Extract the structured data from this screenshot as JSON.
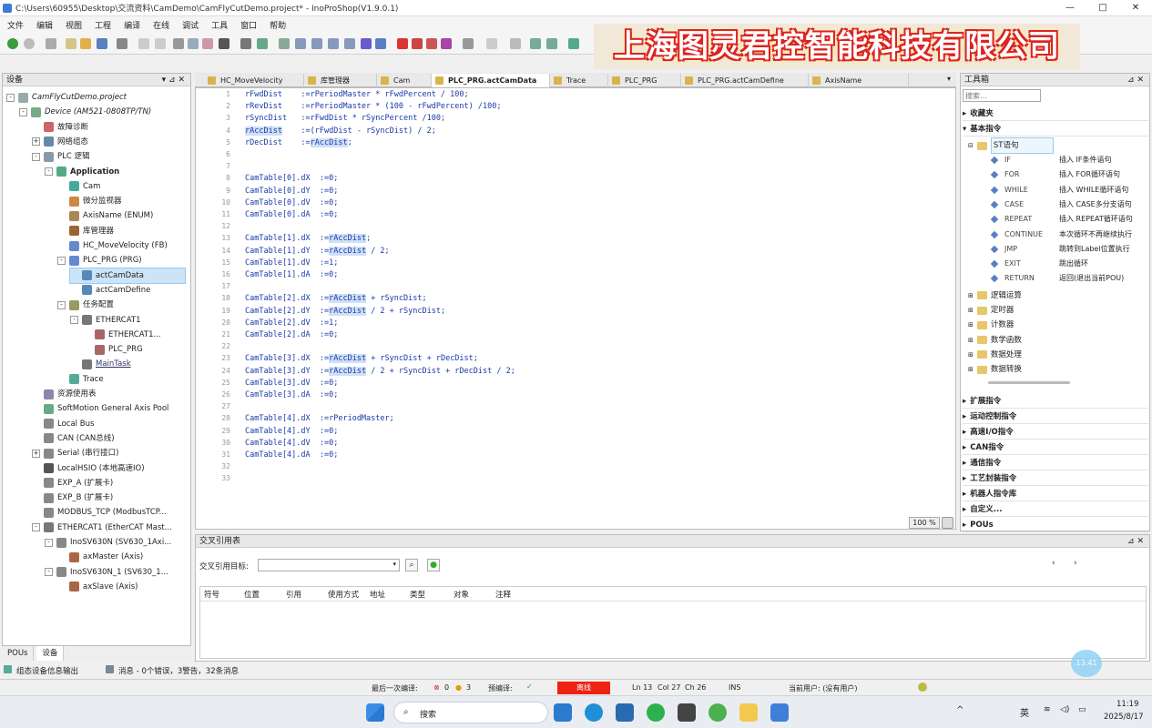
{
  "window": {
    "title": "C:\\Users\\60955\\Desktop\\交流资料\\CamDemo\\CamFlyCutDemo.project* - InoProShop(V1.9.0.1)",
    "minimize": "—",
    "maximize": "□",
    "close": "✕"
  },
  "menu": [
    "文件",
    "编辑",
    "视图",
    "工程",
    "编译",
    "在线",
    "调试",
    "工具",
    "窗口",
    "帮助"
  ],
  "banner": "上海图灵君控智能科技有限公司",
  "device_panel": {
    "title": "设备",
    "pin": "▾ ⊿ ✕",
    "tree": [
      {
        "label": "CamFlyCutDemo.project",
        "indent": 0,
        "expander": "-",
        "icon": "#9aa"
      },
      {
        "label": "Device (AM521-0808TP/TN)",
        "indent": 1,
        "expander": "-",
        "icon": "#7a8"
      },
      {
        "label": "故障诊断",
        "indent": 2,
        "expander": "",
        "icon": "#c66"
      },
      {
        "label": "网络组态",
        "indent": 2,
        "expander": "+",
        "icon": "#68a"
      },
      {
        "label": "PLC 逻辑",
        "indent": 2,
        "expander": "-",
        "icon": "#89a"
      },
      {
        "label": "Application",
        "indent": 3,
        "expander": "-",
        "icon": "#5a8",
        "bold": true
      },
      {
        "label": "Cam",
        "indent": 4,
        "expander": "",
        "icon": "#4a9"
      },
      {
        "label": "微分监视器",
        "indent": 4,
        "expander": "",
        "icon": "#c84"
      },
      {
        "label": "AxisName (ENUM)",
        "indent": 4,
        "expander": "",
        "icon": "#a85"
      },
      {
        "label": "库管理器",
        "indent": 4,
        "expander": "",
        "icon": "#963"
      },
      {
        "label": "HC_MoveVelocity (FB)",
        "indent": 4,
        "expander": "",
        "icon": "#68c"
      },
      {
        "label": "PLC_PRG (PRG)",
        "indent": 4,
        "expander": "-",
        "icon": "#68c"
      },
      {
        "label": "actCamData",
        "indent": 5,
        "expander": "",
        "icon": "#58b",
        "selected": true
      },
      {
        "label": "actCamDefine",
        "indent": 5,
        "expander": "",
        "icon": "#58b"
      },
      {
        "label": "任务配置",
        "indent": 4,
        "expander": "-",
        "icon": "#996"
      },
      {
        "label": "ETHERCAT1",
        "indent": 5,
        "expander": "-",
        "icon": "#777"
      },
      {
        "label": "ETHERCAT1...",
        "indent": 6,
        "expander": "",
        "icon": "#a66"
      },
      {
        "label": "PLC_PRG",
        "indent": 6,
        "expander": "",
        "icon": "#a66"
      },
      {
        "label": "MainTask",
        "indent": 5,
        "expander": "",
        "icon": "#777",
        "underline": true
      },
      {
        "label": "Trace",
        "indent": 4,
        "expander": "",
        "icon": "#5a9"
      },
      {
        "label": "资源使用表",
        "indent": 2,
        "expander": "",
        "icon": "#88a"
      },
      {
        "label": "SoftMotion General Axis Pool",
        "indent": 2,
        "expander": "",
        "icon": "#6a8"
      },
      {
        "label": "Local Bus",
        "indent": 2,
        "expander": "",
        "icon": "#888"
      },
      {
        "label": "CAN (CAN总线)",
        "indent": 2,
        "expander": "",
        "icon": "#888"
      },
      {
        "label": "Serial (串行接口)",
        "indent": 2,
        "expander": "+",
        "icon": "#888"
      },
      {
        "label": "LocalHSIO (本地高速IO)",
        "indent": 2,
        "expander": "",
        "icon": "#555"
      },
      {
        "label": "EXP_A (扩展卡)",
        "indent": 2,
        "expander": "",
        "icon": "#888"
      },
      {
        "label": "EXP_B (扩展卡)",
        "indent": 2,
        "expander": "",
        "icon": "#888"
      },
      {
        "label": "MODBUS_TCP (ModbusTCP...",
        "indent": 2,
        "expander": "",
        "icon": "#888"
      },
      {
        "label": "ETHERCAT1 (EtherCAT Mast...",
        "indent": 2,
        "expander": "-",
        "icon": "#777"
      },
      {
        "label": "InoSV630N (SV630_1Axi...",
        "indent": 3,
        "expander": "-",
        "icon": "#888"
      },
      {
        "label": "axMaster (Axis)",
        "indent": 4,
        "expander": "",
        "icon": "#a64"
      },
      {
        "label": "InoSV630N_1 (SV630_1...",
        "indent": 3,
        "expander": "-",
        "icon": "#888"
      },
      {
        "label": "axSlave (Axis)",
        "indent": 4,
        "expander": "",
        "icon": "#a64"
      }
    ],
    "bottom_tabs": [
      "POUs",
      "设备"
    ]
  },
  "editor_tabs": [
    {
      "label": "HC_MoveVelocity",
      "active": false
    },
    {
      "label": "库管理器",
      "active": false
    },
    {
      "label": "Cam",
      "active": false
    },
    {
      "label": "PLC_PRG.actCamData",
      "active": true
    },
    {
      "label": "Trace",
      "active": false
    },
    {
      "label": "PLC_PRG",
      "active": false
    },
    {
      "label": "PLC_PRG.actCamDefine",
      "active": false
    },
    {
      "label": "AxisName",
      "active": false
    }
  ],
  "code_lines": [
    {
      "n": "1",
      "text": "rFwdDist    :=rPeriodMaster * rFwdPercent / 100;"
    },
    {
      "n": "2",
      "text": "rRevDist    :=rPeriodMaster * (100 - rFwdPercent) /100;"
    },
    {
      "n": "3",
      "text": "rSyncDist   :=rFwdDist * rSyncPercent /100;"
    },
    {
      "n": "4",
      "text": "rAccDist    :=(rFwdDist - rSyncDist) / 2;"
    },
    {
      "n": "5",
      "text": "rDecDist    :=rAccDist;"
    },
    {
      "n": "6",
      "text": ""
    },
    {
      "n": "7",
      "text": ""
    },
    {
      "n": "8",
      "text": "CamTable[0].dX  :=0;"
    },
    {
      "n": "9",
      "text": "CamTable[0].dY  :=0;"
    },
    {
      "n": "10",
      "text": "CamTable[0].dV  :=0;"
    },
    {
      "n": "11",
      "text": "CamTable[0].dA  :=0;"
    },
    {
      "n": "12",
      "text": ""
    },
    {
      "n": "13",
      "text": "CamTable[1].dX  :=rAccDist;"
    },
    {
      "n": "14",
      "text": "CamTable[1].dY  :=rAccDist / 2;"
    },
    {
      "n": "15",
      "text": "CamTable[1].dV  :=1;"
    },
    {
      "n": "16",
      "text": "CamTable[1].dA  :=0;"
    },
    {
      "n": "17",
      "text": ""
    },
    {
      "n": "18",
      "text": "CamTable[2].dX  :=rAccDist + rSyncDist;"
    },
    {
      "n": "19",
      "text": "CamTable[2].dY  :=rAccDist / 2 + rSyncDist;"
    },
    {
      "n": "20",
      "text": "CamTable[2].dV  :=1;"
    },
    {
      "n": "21",
      "text": "CamTable[2].dA  :=0;"
    },
    {
      "n": "22",
      "text": ""
    },
    {
      "n": "23",
      "text": "CamTable[3].dX  :=rAccDist + rSyncDist + rDecDist;"
    },
    {
      "n": "24",
      "text": "CamTable[3].dY  :=rAccDist / 2 + rSyncDist + rDecDist / 2;"
    },
    {
      "n": "25",
      "text": "CamTable[3].dV  :=0;"
    },
    {
      "n": "26",
      "text": "CamTable[3].dA  :=0;"
    },
    {
      "n": "27",
      "text": ""
    },
    {
      "n": "28",
      "text": "CamTable[4].dX  :=rPeriodMaster;"
    },
    {
      "n": "29",
      "text": "CamTable[4].dY  :=0;"
    },
    {
      "n": "30",
      "text": "CamTable[4].dV  :=0;"
    },
    {
      "n": "31",
      "text": "CamTable[4].dA  :=0;"
    },
    {
      "n": "32",
      "text": ""
    },
    {
      "n": "33",
      "text": ""
    }
  ],
  "zoom": "100 %",
  "toolbox": {
    "title": "工具箱",
    "search_placeholder": "搜索...",
    "groups_top": [
      {
        "label": "收藏夹",
        "expander": "▸"
      },
      {
        "label": "基本指令",
        "expander": "▾"
      }
    ],
    "st_folder": "ST语句",
    "st_items": [
      {
        "key": "IF",
        "desc": "插入 IF条件语句"
      },
      {
        "key": "FOR",
        "desc": "插入 FOR循环语句"
      },
      {
        "key": "WHILE",
        "desc": "插入 WHILE循环语句"
      },
      {
        "key": "CASE",
        "desc": "插入 CASE多分支语句"
      },
      {
        "key": "REPEAT",
        "desc": "插入 REPEAT循环语句"
      },
      {
        "key": "CONTINUE",
        "desc": "本次循环不再继续执行"
      },
      {
        "key": "JMP",
        "desc": "跳转到Label位置执行"
      },
      {
        "key": "EXIT",
        "desc": "跳出循环"
      },
      {
        "key": "RETURN",
        "desc": "返回(退出当前POU)"
      }
    ],
    "sub_folders": [
      "逻辑运算",
      "定时器",
      "计数器",
      "数学函数",
      "数据处理",
      "数据转换"
    ],
    "groups_bottom": [
      "扩展指令",
      "运动控制指令",
      "高速I/O指令",
      "CAN指令",
      "通信指令",
      "工艺封装指令",
      "机器人指令库",
      "自定义...",
      "POUs"
    ]
  },
  "xref": {
    "title": "交叉引用表",
    "target_label": "交叉引用目标:",
    "columns": [
      "符号",
      "位置",
      "引用",
      "使用方式",
      "地址",
      "类型",
      "对象",
      "注释"
    ]
  },
  "messages": {
    "tab1": "组态设备信息输出",
    "tab2": "消息 - 0个错误，3警告，32条消息"
  },
  "status": {
    "last_compile": "最后一次编译:",
    "errors": "0",
    "warnings": "3",
    "precompile": "预编译:",
    "precompile_ok": "✓",
    "mode": "离线",
    "ln": "Ln 13",
    "col": "Col 27",
    "ch": "Ch 26",
    "ins": "INS",
    "user": "当前用户: (没有用户)"
  },
  "taskbar": {
    "search": "搜索",
    "lang": "英",
    "time": "11:19",
    "date": "2025/8/17"
  },
  "bubble": "13:41"
}
